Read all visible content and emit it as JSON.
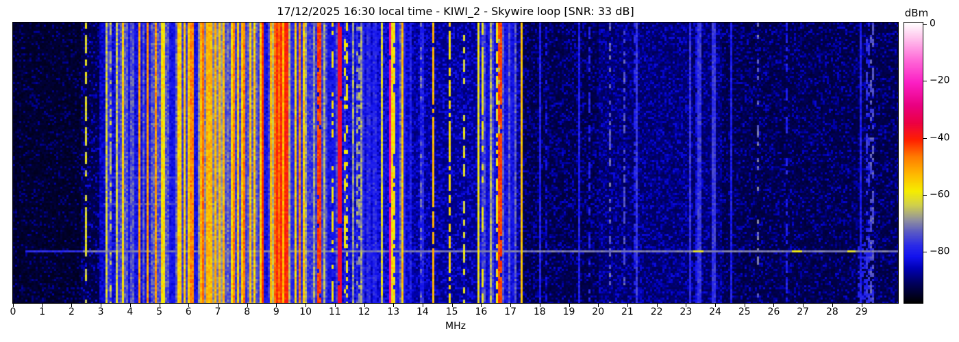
{
  "figure": {
    "title": "17/12/2025 16:30 local time - KIWI_2 - Skywire loop [SNR: 33 dB]"
  },
  "axes": {
    "xlabel": "MHz",
    "x_ticks": [
      0,
      1,
      2,
      3,
      4,
      5,
      6,
      7,
      8,
      9,
      10,
      11,
      12,
      13,
      14,
      15,
      16,
      17,
      18,
      19,
      20,
      21,
      22,
      23,
      24,
      25,
      26,
      27,
      28,
      29
    ]
  },
  "colorbar": {
    "label": "dBm",
    "ticks": [
      0,
      -20,
      -40,
      -60,
      -80
    ],
    "vmax": 0,
    "vmin": -98
  },
  "chart_data": {
    "type": "heatmap",
    "title": "17/12/2025 16:30 local time - KIWI_2 - Skywire loop [SNR: 33 dB]",
    "xlabel": "MHz",
    "x_range_mhz": [
      0,
      30.25
    ],
    "y_axis": "time (waterfall, no tick labels)",
    "value_unit": "dBm",
    "value_range": [
      -98,
      0
    ],
    "legend_position": "right-colorbar",
    "grid": false,
    "colormap_stops": [
      {
        "v": 0,
        "color": "#ffffff"
      },
      {
        "v": -5,
        "color": "#ffc8ee"
      },
      {
        "v": -13,
        "color": "#ff6ad8"
      },
      {
        "v": -21,
        "color": "#fb1fc4"
      },
      {
        "v": -29,
        "color": "#e90080"
      },
      {
        "v": -35,
        "color": "#ec0044"
      },
      {
        "v": -41,
        "color": "#ff2000"
      },
      {
        "v": -47,
        "color": "#ff7c00"
      },
      {
        "v": -53,
        "color": "#ffb800"
      },
      {
        "v": -59,
        "color": "#f6ee00"
      },
      {
        "v": -64,
        "color": "#cfcf4e"
      },
      {
        "v": -69,
        "color": "#91919e"
      },
      {
        "v": -73,
        "color": "#5d5dc2"
      },
      {
        "v": -78,
        "color": "#2a2ae8"
      },
      {
        "v": -82,
        "color": "#1212ee"
      },
      {
        "v": -86,
        "color": "#0000b4"
      },
      {
        "v": -91,
        "color": "#000060"
      },
      {
        "v": -98,
        "color": "#000000"
      }
    ],
    "noise_regions": [
      {
        "f0": 0.0,
        "f1": 2.35,
        "base": -96,
        "p": 0.18,
        "lift": 9
      },
      {
        "f0": 2.35,
        "f1": 3.15,
        "base": -94,
        "p": 0.3,
        "lift": 11
      },
      {
        "f0": 3.15,
        "f1": 13.6,
        "base": -87,
        "p": 0.55,
        "lift": 8
      },
      {
        "f0": 13.6,
        "f1": 17.45,
        "base": -90,
        "p": 0.45,
        "lift": 9
      },
      {
        "f0": 17.45,
        "f1": 20.0,
        "base": -94,
        "p": 0.35,
        "lift": 10
      },
      {
        "f0": 20.0,
        "f1": 24.2,
        "base": -92,
        "p": 0.45,
        "lift": 9
      },
      {
        "f0": 24.2,
        "f1": 30.25,
        "base": -94,
        "p": 0.32,
        "lift": 10
      }
    ],
    "stripe_clusters": [
      {
        "f0": 2.95,
        "f1": 3.62,
        "bg": -85,
        "comps": [
          {
            "p": 0.28,
            "v": -77,
            "fl": 8
          },
          {
            "p": 0.08,
            "v": -64,
            "fl": 10
          }
        ]
      },
      {
        "f0": 3.62,
        "f1": 4.12,
        "bg": -82,
        "comps": [
          {
            "p": 0.3,
            "v": -57,
            "fl": 9
          },
          {
            "p": 0.08,
            "v": -50,
            "fl": 8
          },
          {
            "p": 0.28,
            "v": -74,
            "fl": 8
          }
        ]
      },
      {
        "f0": 4.12,
        "f1": 5.32,
        "bg": -83,
        "comps": [
          {
            "p": 0.2,
            "v": -58,
            "fl": 9
          },
          {
            "p": 0.05,
            "v": -50,
            "fl": 8
          },
          {
            "p": 0.33,
            "v": -74,
            "fl": 8
          }
        ]
      },
      {
        "f0": 5.32,
        "f1": 5.62,
        "bg": -82,
        "comps": [
          {
            "p": 0.18,
            "v": -63,
            "fl": 8
          },
          {
            "p": 0.25,
            "v": -73,
            "fl": 8
          }
        ]
      },
      {
        "f0": 5.62,
        "f1": 6.18,
        "bg": -76,
        "comps": [
          {
            "p": 0.42,
            "v": -55,
            "fl": 7
          },
          {
            "p": 0.12,
            "v": -48,
            "fl": 7
          },
          {
            "p": 0.16,
            "v": -70,
            "fl": 8
          }
        ]
      },
      {
        "f0": 6.18,
        "f1": 6.34,
        "bg": -82,
        "comps": [
          {
            "p": 0.45,
            "v": -77,
            "fl": 8
          }
        ]
      },
      {
        "f0": 6.34,
        "f1": 7.22,
        "bg": -70,
        "comps": [
          {
            "p": 0.36,
            "v": -53,
            "fl": 7
          },
          {
            "p": 0.22,
            "v": -46,
            "fl": 6
          },
          {
            "p": 0.12,
            "v": -41,
            "fl": 5
          },
          {
            "p": 0.1,
            "v": -70,
            "fl": 8
          }
        ]
      },
      {
        "f0": 7.22,
        "f1": 7.62,
        "bg": -75,
        "comps": [
          {
            "p": 0.34,
            "v": -56,
            "fl": 8
          },
          {
            "p": 0.14,
            "v": -48,
            "fl": 7
          },
          {
            "p": 0.18,
            "v": -72,
            "fl": 8
          }
        ]
      },
      {
        "f0": 7.62,
        "f1": 8.56,
        "bg": -76,
        "comps": [
          {
            "p": 0.32,
            "v": -55,
            "fl": 8
          },
          {
            "p": 0.16,
            "v": -47,
            "fl": 7
          },
          {
            "p": 0.06,
            "v": -42,
            "fl": 5
          },
          {
            "p": 0.2,
            "v": -73,
            "fl": 8
          }
        ]
      },
      {
        "f0": 8.56,
        "f1": 8.78,
        "bg": -83,
        "comps": [
          {
            "p": 0.45,
            "v": -77,
            "fl": 8
          }
        ]
      },
      {
        "f0": 8.78,
        "f1": 9.45,
        "bg": -66,
        "comps": [
          {
            "p": 0.3,
            "v": -46,
            "fl": 6
          },
          {
            "p": 0.17,
            "v": -41,
            "fl": 5
          },
          {
            "p": 0.27,
            "v": -53,
            "fl": 7
          },
          {
            "p": 0.08,
            "v": -70,
            "fl": 8
          }
        ]
      },
      {
        "f0": 9.45,
        "f1": 9.95,
        "bg": -78,
        "comps": [
          {
            "p": 0.36,
            "v": -55,
            "fl": 8
          },
          {
            "p": 0.08,
            "v": -48,
            "fl": 7
          },
          {
            "p": 0.22,
            "v": -73,
            "fl": 8
          }
        ]
      },
      {
        "f0": 9.95,
        "f1": 10.4,
        "bg": -84,
        "comps": [
          {
            "p": 0.14,
            "v": -68,
            "fl": 8
          },
          {
            "p": 0.28,
            "v": -77,
            "fl": 8
          }
        ]
      },
      {
        "f0": 10.52,
        "f1": 11.12,
        "bg": -82,
        "comps": [
          {
            "p": 0.16,
            "v": -67,
            "fl": 8
          },
          {
            "p": 0.1,
            "v": -60,
            "fl": 9
          },
          {
            "p": 0.28,
            "v": -76,
            "fl": 8
          }
        ]
      },
      {
        "f0": 11.22,
        "f1": 12.8,
        "bg": -85,
        "comps": [
          {
            "p": 0.09,
            "v": -68,
            "fl": 9
          },
          {
            "p": 0.05,
            "v": -62,
            "fl": 10
          },
          {
            "p": 0.22,
            "v": -79,
            "fl": 8
          }
        ]
      },
      {
        "f0": 12.95,
        "f1": 13.42,
        "bg": -80,
        "comps": [
          {
            "p": 0.2,
            "v": -58,
            "fl": 9
          },
          {
            "p": 0.25,
            "v": -72,
            "fl": 8
          }
        ]
      },
      {
        "f0": 13.42,
        "f1": 14.25,
        "bg": -88,
        "comps": [
          {
            "p": 0.07,
            "v": -70,
            "fl": 9
          },
          {
            "p": 0.18,
            "v": -80,
            "fl": 8
          }
        ]
      },
      {
        "f0": 14.4,
        "f1": 15.3,
        "bg": -91,
        "comps": [
          {
            "p": 0.06,
            "v": -73,
            "fl": 8
          }
        ]
      },
      {
        "f0": 15.85,
        "f1": 16.72,
        "bg": -83,
        "comps": [
          {
            "p": 0.18,
            "v": -67,
            "fl": 9
          },
          {
            "p": 0.1,
            "v": -60,
            "fl": 9
          },
          {
            "p": 0.24,
            "v": -76,
            "fl": 8
          }
        ]
      },
      {
        "f0": 16.72,
        "f1": 17.18,
        "bg": -82,
        "comps": [
          {
            "p": 0.38,
            "v": -74,
            "fl": 8
          }
        ]
      },
      {
        "f0": 17.5,
        "f1": 20.0,
        "bg": null,
        "comps": [
          {
            "p": 0.04,
            "v": -80,
            "fl": 6
          }
        ]
      },
      {
        "f0": 20.1,
        "f1": 24.3,
        "bg": null,
        "comps": [
          {
            "p": 0.05,
            "v": -77,
            "fl": 6
          }
        ]
      },
      {
        "f0": 24.3,
        "f1": 30.25,
        "bg": null,
        "comps": [
          {
            "p": 0.035,
            "v": -80,
            "fl": 6
          }
        ]
      }
    ],
    "spectral_lines": [
      {
        "f": 2.505,
        "w": 3,
        "v": -62,
        "dash": 0.35,
        "fl": 8,
        "run": 3
      },
      {
        "f": 3.31,
        "w": 2,
        "v": -66,
        "dash": 0.5,
        "fl": 8,
        "run": 2
      },
      {
        "f": 10.46,
        "w": 3,
        "v": -43,
        "dash": 0.05,
        "fl": 6,
        "run": 2
      },
      {
        "f": 10.94,
        "w": 2,
        "v": -58,
        "dash": 0.55,
        "fl": 8,
        "run": 2
      },
      {
        "f": 11.17,
        "w": 3,
        "v": -37,
        "dash": 0.04,
        "fl": 4,
        "run": 2
      },
      {
        "f": 11.38,
        "w": 2,
        "v": -60,
        "dash": 0.6,
        "fl": 8,
        "run": 2
      },
      {
        "f": 11.8,
        "w": 2,
        "v": -68,
        "dash": 0.5,
        "fl": 7,
        "run": 2
      },
      {
        "f": 12.88,
        "w": 3,
        "v": -26,
        "dash": 0.04,
        "fl": 4,
        "run": 2
      },
      {
        "f": 13.06,
        "w": 2,
        "v": -58,
        "dash": 0.3,
        "fl": 8,
        "run": 2
      },
      {
        "f": 13.3,
        "w": 3,
        "v": -54,
        "dash": 0.15,
        "fl": 7,
        "run": 2
      },
      {
        "f": 13.95,
        "w": 2,
        "v": -72,
        "dash": 0.6,
        "fl": 7,
        "run": 2
      },
      {
        "f": 14.37,
        "w": 3,
        "v": -53,
        "dash": 0.06,
        "fl": 5,
        "run": 2
      },
      {
        "f": 14.93,
        "w": 3,
        "v": -57,
        "dash": 0.18,
        "fl": 6,
        "run": 2
      },
      {
        "f": 15.41,
        "w": 3,
        "v": -62,
        "dash": 0.45,
        "fl": 6,
        "run": 3
      },
      {
        "f": 16.03,
        "w": 2,
        "v": -61,
        "dash": 0.45,
        "fl": 7,
        "run": 3
      },
      {
        "f": 16.33,
        "w": 2,
        "v": -68,
        "dash": 0.4,
        "fl": 7,
        "run": 2
      },
      {
        "f": 16.52,
        "w": 2,
        "v": -60,
        "dash": 0.35,
        "fl": 7,
        "run": 2
      },
      {
        "f": 16.65,
        "w": 3,
        "v": -43,
        "dash": 0.08,
        "fl": 5,
        "run": 2
      },
      {
        "f": 17.39,
        "w": 3,
        "v": -54,
        "dash": 0.04,
        "fl": 4,
        "run": 2
      },
      {
        "f": 18.25,
        "w": 2,
        "v": -83,
        "dash": 0.5,
        "fl": 6,
        "run": 2
      },
      {
        "f": 19.72,
        "w": 2,
        "v": -80,
        "dash": 0.5,
        "fl": 6,
        "run": 2
      },
      {
        "f": 20.42,
        "w": 2,
        "v": -73,
        "dash": 0.55,
        "fl": 6,
        "run": 2
      },
      {
        "f": 20.92,
        "w": 2,
        "v": -74,
        "dash": 0.55,
        "fl": 6,
        "run": 2
      },
      {
        "f": 21.22,
        "w": 2,
        "v": -80,
        "dash": 0.5,
        "fl": 6,
        "run": 2
      },
      {
        "f": 23.38,
        "w": 5,
        "v": -82,
        "dash": 0.25,
        "fl": 6,
        "run": 2
      },
      {
        "f": 25.45,
        "w": 2,
        "v": -72,
        "dash": 0.68,
        "fl": 6,
        "run": 2
      },
      {
        "f": 26.42,
        "w": 2,
        "v": -80,
        "dash": 0.5,
        "fl": 6,
        "run": 2
      },
      {
        "f": 29.22,
        "w": 2,
        "v": -78,
        "dash": 0.55,
        "fl": 6,
        "run": 2
      },
      {
        "f": 29.37,
        "w": 3,
        "v": -74,
        "dash": 0.5,
        "fl": 6,
        "run": 2
      }
    ],
    "time_events": [
      {
        "y0": 0.81,
        "y1": 0.817,
        "f0": 2.4,
        "f1": 30.25,
        "v": -71,
        "segments": [
          {
            "f0": 23.25,
            "f1": 23.6,
            "v": -62
          },
          {
            "f0": 26.6,
            "f1": 27.0,
            "v": -60
          },
          {
            "f0": 28.5,
            "f1": 28.8,
            "v": -62
          }
        ]
      },
      {
        "y0": 0.81,
        "y1": 0.817,
        "f0": 0.4,
        "f1": 2.4,
        "v": -78
      },
      {
        "y0": 0.549,
        "y1": 0.556,
        "f0": 3.1,
        "f1": 5.6,
        "v": -75
      },
      {
        "y0": 0.642,
        "y1": 0.649,
        "f0": 3.1,
        "f1": 5.6,
        "v": -75
      },
      {
        "y0": 0.78,
        "y1": 1.0,
        "f0": 28.85,
        "f1": 29.45,
        "v": -79,
        "p": 0.45
      }
    ]
  }
}
